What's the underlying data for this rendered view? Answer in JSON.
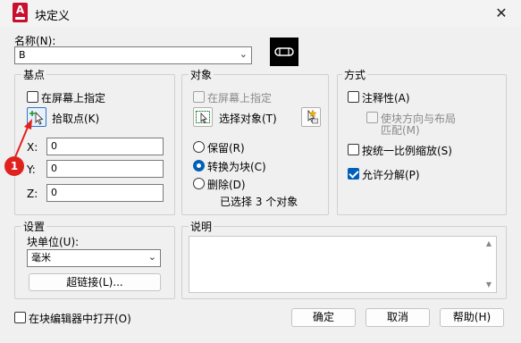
{
  "window": {
    "title": "块定义",
    "close_glyph": "✕",
    "app_icon_letter": "A"
  },
  "name": {
    "label": "名称(N):",
    "value": "B"
  },
  "base_point": {
    "group_title": "基点",
    "specify_on_screen": "在屏幕上指定",
    "pick_point": "拾取点(K)",
    "x_label": "X:",
    "x_value": "0",
    "y_label": "Y:",
    "y_value": "0",
    "z_label": "Z:",
    "z_value": "0"
  },
  "objects": {
    "group_title": "对象",
    "specify_on_screen": "在屏幕上指定",
    "select_objects": "选择对象(T)",
    "retain": "保留(R)",
    "convert_to_block": "转换为块(C)",
    "delete": "删除(D)",
    "selected_count": "已选择 3 个对象"
  },
  "behavior": {
    "group_title": "方式",
    "annotative": "注释性(A)",
    "match_orientation_line1": "使块方向与布局",
    "match_orientation_line2": "匹配(M)",
    "scale_uniformly": "按统一比例缩放(S)",
    "allow_exploding": "允许分解(P)"
  },
  "settings": {
    "group_title": "设置",
    "block_unit_label": "块单位(U):",
    "block_unit_value": "毫米",
    "hyperlink": "超链接(L)..."
  },
  "description": {
    "group_title": "说明",
    "text": ""
  },
  "footer": {
    "open_in_editor": "在块编辑器中打开(O)",
    "ok": "确定",
    "cancel": "取消",
    "help": "帮助(H)"
  },
  "annotation": {
    "badge_number": "1",
    "color": "#e0221f"
  },
  "colors": {
    "accent": "#005fb8",
    "app_red": "#c8102e"
  }
}
